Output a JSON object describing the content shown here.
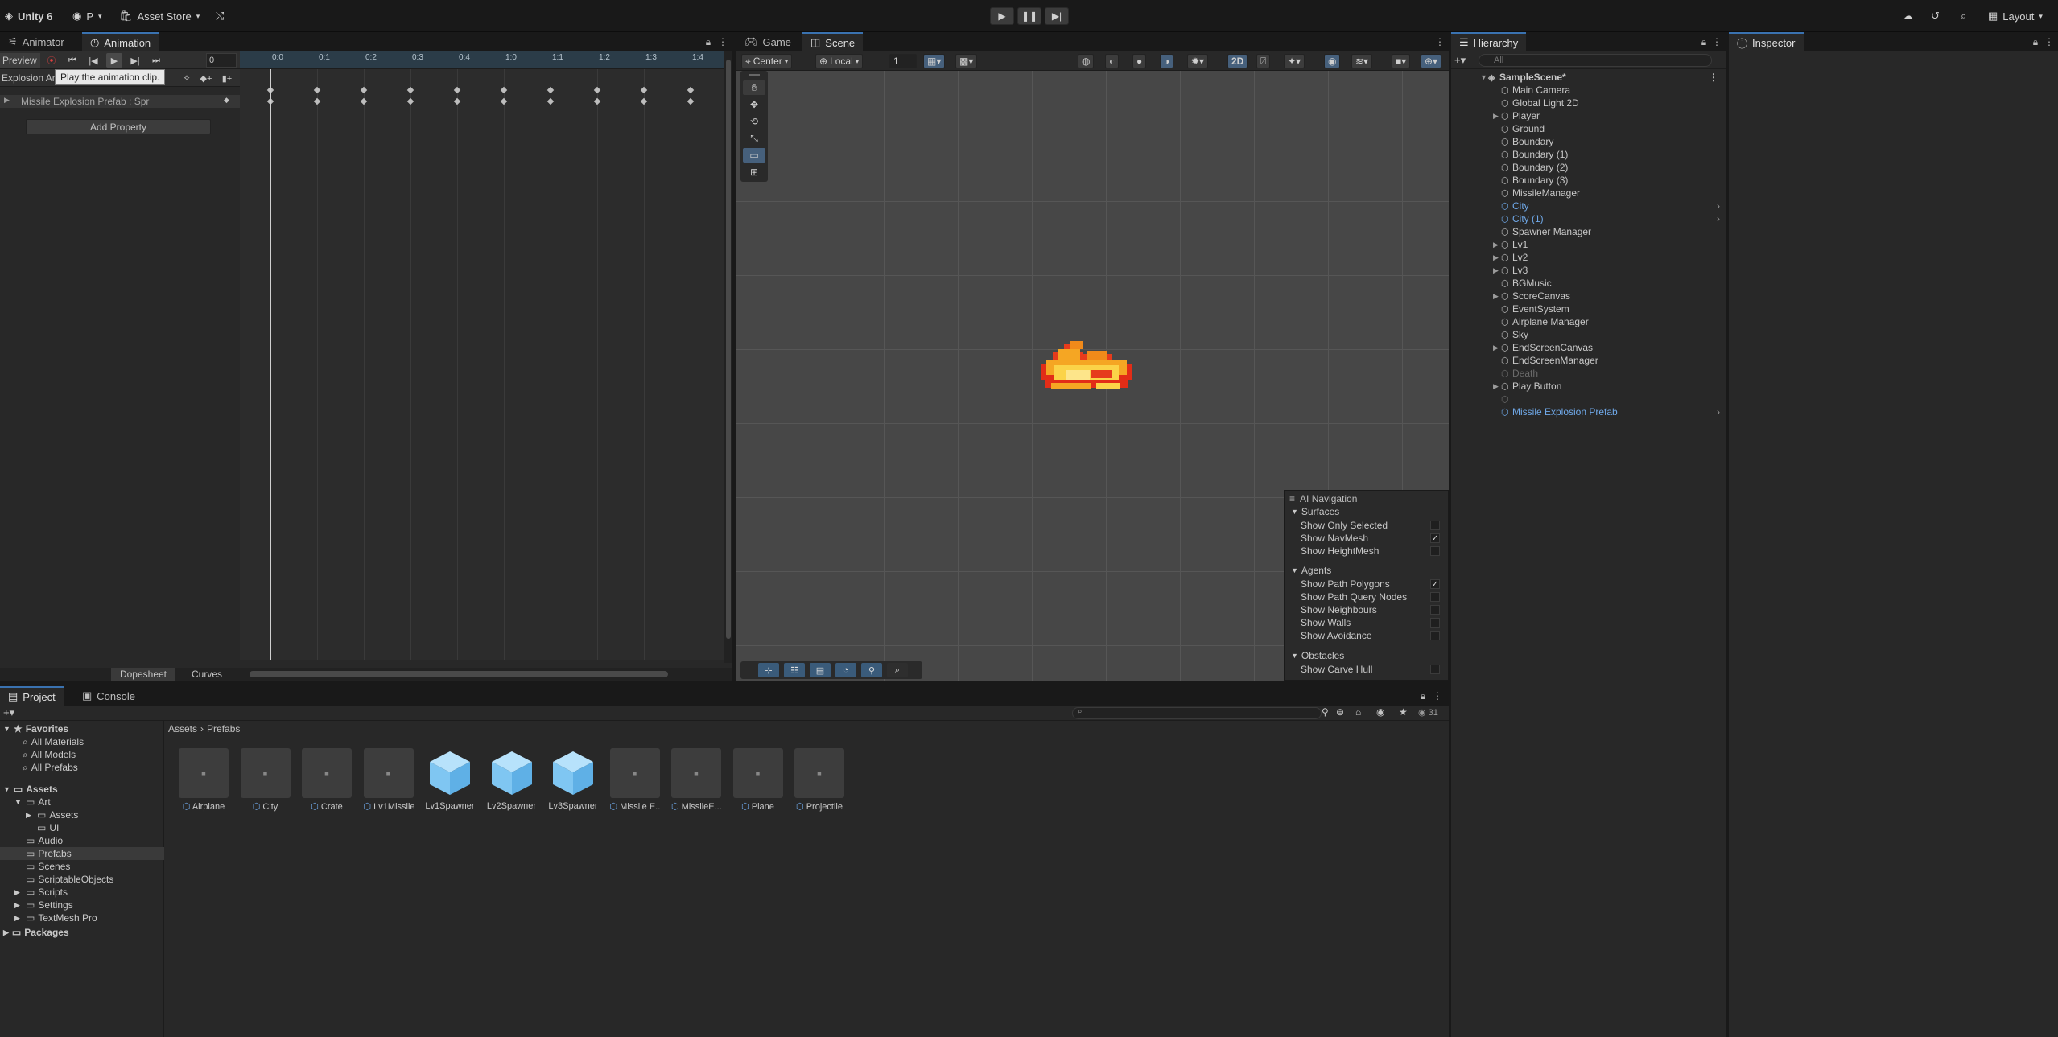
{
  "topbar": {
    "app_title": "Unity 6",
    "account": "P",
    "asset_store": "Asset Store",
    "layout_label": "Layout"
  },
  "animation": {
    "tabs": [
      "Animator",
      "Animation"
    ],
    "preview_label": "Preview",
    "frame_value": "0",
    "clip_name": "Explosion An",
    "tooltip": "Play the animation clip.",
    "property_row": "Missile Explosion Prefab : Spr",
    "add_property": "Add Property",
    "ticks": [
      "0:0",
      "0:1",
      "0:2",
      "0:3",
      "0:4",
      "1:0",
      "1:1",
      "1:2",
      "1:3",
      "1:4"
    ],
    "bottom_tabs": [
      "Dopesheet",
      "Curves"
    ]
  },
  "scene": {
    "tabs": [
      "Game",
      "Scene"
    ],
    "pivot": "Center",
    "space": "Local",
    "snap_value": "1",
    "mode_2d": "2D",
    "ai_nav": {
      "title": "AI Navigation",
      "surfaces_header": "Surfaces",
      "surfaces": [
        {
          "label": "Show Only Selected",
          "checked": false
        },
        {
          "label": "Show NavMesh",
          "checked": true
        },
        {
          "label": "Show HeightMesh",
          "checked": false
        }
      ],
      "agents_header": "Agents",
      "agents": [
        {
          "label": "Show Path Polygons",
          "checked": true
        },
        {
          "label": "Show Path Query Nodes",
          "checked": false
        },
        {
          "label": "Show Neighbours",
          "checked": false
        },
        {
          "label": "Show Walls",
          "checked": false
        },
        {
          "label": "Show Avoidance",
          "checked": false
        }
      ],
      "obstacles_header": "Obstacles",
      "obstacles": [
        {
          "label": "Show Carve Hull",
          "checked": false
        }
      ]
    }
  },
  "hierarchy": {
    "tab": "Hierarchy",
    "search_placeholder": "All",
    "scene_name": "SampleScene*",
    "items": [
      {
        "label": "Main Camera",
        "arrow": false,
        "style": "normal"
      },
      {
        "label": "Global Light 2D",
        "arrow": false,
        "style": "normal"
      },
      {
        "label": "Player",
        "arrow": true,
        "style": "normal"
      },
      {
        "label": "Ground",
        "arrow": false,
        "style": "normal"
      },
      {
        "label": "Boundary",
        "arrow": false,
        "style": "normal"
      },
      {
        "label": "Boundary (1)",
        "arrow": false,
        "style": "normal"
      },
      {
        "label": "Boundary (2)",
        "arrow": false,
        "style": "normal"
      },
      {
        "label": "Boundary (3)",
        "arrow": false,
        "style": "normal"
      },
      {
        "label": "MissileManager",
        "arrow": false,
        "style": "normal"
      },
      {
        "label": "City",
        "arrow": false,
        "style": "prefab"
      },
      {
        "label": "City (1)",
        "arrow": false,
        "style": "prefab"
      },
      {
        "label": "Spawner Manager",
        "arrow": false,
        "style": "normal"
      },
      {
        "label": "Lv1",
        "arrow": true,
        "style": "normal"
      },
      {
        "label": "Lv2",
        "arrow": true,
        "style": "normal"
      },
      {
        "label": "Lv3",
        "arrow": true,
        "style": "normal"
      },
      {
        "label": "BGMusic",
        "arrow": false,
        "style": "normal"
      },
      {
        "label": "ScoreCanvas",
        "arrow": true,
        "style": "normal"
      },
      {
        "label": "EventSystem",
        "arrow": false,
        "style": "normal"
      },
      {
        "label": "Airplane Manager",
        "arrow": false,
        "style": "normal"
      },
      {
        "label": "Sky",
        "arrow": false,
        "style": "normal"
      },
      {
        "label": "EndScreenCanvas",
        "arrow": true,
        "style": "normal"
      },
      {
        "label": "EndScreenManager",
        "arrow": false,
        "style": "normal"
      },
      {
        "label": "Death",
        "arrow": false,
        "style": "disabled"
      },
      {
        "label": "Play Button",
        "arrow": true,
        "style": "normal"
      },
      {
        "label": "",
        "arrow": false,
        "style": "disabled"
      },
      {
        "label": "Missile Explosion Prefab",
        "arrow": false,
        "style": "prefab"
      }
    ]
  },
  "inspector": {
    "tab": "Inspector"
  },
  "project": {
    "tabs": [
      "Project",
      "Console"
    ],
    "breadcrumb": [
      "Assets",
      "Prefabs"
    ],
    "count": "31",
    "favorites_label": "Favorites",
    "favorites": [
      "All Materials",
      "All Models",
      "All Prefabs"
    ],
    "assets_label": "Assets",
    "tree": [
      {
        "label": "Art",
        "indent": 1,
        "arrow": "open"
      },
      {
        "label": "Assets",
        "indent": 2,
        "arrow": "closed"
      },
      {
        "label": "UI",
        "indent": 2,
        "arrow": "none"
      },
      {
        "label": "Audio",
        "indent": 1,
        "arrow": "none"
      },
      {
        "label": "Prefabs",
        "indent": 1,
        "arrow": "none"
      },
      {
        "label": "Scenes",
        "indent": 1,
        "arrow": "none"
      },
      {
        "label": "ScriptableObjects",
        "indent": 1,
        "arrow": "none"
      },
      {
        "label": "Scripts",
        "indent": 1,
        "arrow": "closed"
      },
      {
        "label": "Settings",
        "indent": 1,
        "arrow": "closed"
      },
      {
        "label": "TextMesh Pro",
        "indent": 1,
        "arrow": "closed"
      }
    ],
    "packages_label": "Packages",
    "assets": [
      {
        "label": "Airplane",
        "kind": "sprite",
        "prefab": true
      },
      {
        "label": "City",
        "kind": "sprite",
        "prefab": true
      },
      {
        "label": "Crate",
        "kind": "sprite",
        "prefab": true
      },
      {
        "label": "Lv1Missile",
        "kind": "sprite",
        "prefab": true
      },
      {
        "label": "Lv1Spawner",
        "kind": "cube",
        "prefab": false
      },
      {
        "label": "Lv2Spawner",
        "kind": "cube",
        "prefab": false
      },
      {
        "label": "Lv3Spawner",
        "kind": "cube",
        "prefab": false
      },
      {
        "label": "Missile E...",
        "kind": "sprite",
        "prefab": true
      },
      {
        "label": "MissileE...",
        "kind": "sprite",
        "prefab": true
      },
      {
        "label": "Plane",
        "kind": "sprite",
        "prefab": true
      },
      {
        "label": "Projectile",
        "kind": "sprite",
        "prefab": true
      }
    ]
  }
}
